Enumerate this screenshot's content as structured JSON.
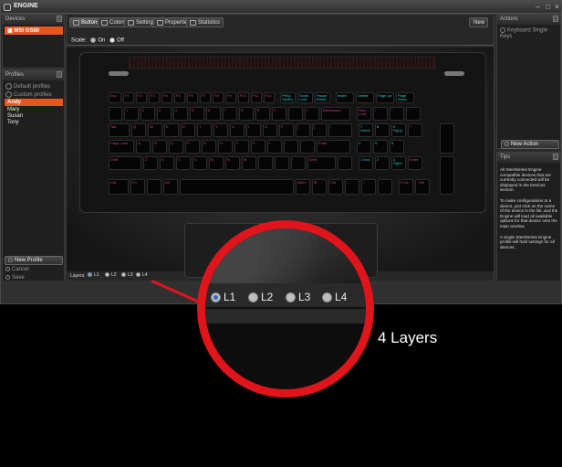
{
  "window": {
    "title": "ENGINE",
    "icon": "engine-logo-icon"
  },
  "devices": {
    "header": "Devices",
    "selected": "MSI GS60"
  },
  "profiles": {
    "header": "Profiles",
    "default_label": "Default profiles",
    "custom_label": "Custom profiles",
    "items": [
      "Andy",
      "Mary",
      "Susan",
      "Tony"
    ],
    "selected": "Andy",
    "new_profile_label": "New Profile",
    "cancel_label": "Cancel",
    "save_label": "Save"
  },
  "tabs": [
    {
      "label": "Buttons",
      "icon": "buttons-icon"
    },
    {
      "label": "Colors",
      "icon": "colors-icon"
    },
    {
      "label": "Settings",
      "icon": "settings-icon"
    },
    {
      "label": "Properties",
      "icon": "properties-icon"
    },
    {
      "label": "Statistics",
      "icon": "statistics-icon"
    }
  ],
  "new_label": "New",
  "scale": {
    "label": "Scale:",
    "on": "On",
    "off": "Off"
  },
  "actions": {
    "header": "Actions",
    "item": "Keyboard Single Keys",
    "new_action_label": "New Action"
  },
  "tips": {
    "header": "Tips",
    "p1": "All SteelSeries Engine compatible devices that are currently connected will be displayed in the Devices section.",
    "p2": "To make configurations to a device, just click on the name of the device in the list, and the Engine will load all available options for that device onto the main window.",
    "p3": "A single SteelSeries Engine profile will hold settings for all devices."
  },
  "layers": {
    "label": "Layers:",
    "items": [
      "L1",
      "L2",
      "L3",
      "L4"
    ],
    "selected": "L1"
  },
  "callout": "4 Layers",
  "keys": {
    "fn_row": [
      "Esc",
      "F1",
      "F2",
      "F3",
      "F4",
      "F5",
      "F6",
      "F7",
      "F8",
      "F9",
      "F10",
      "F11",
      "F12",
      "PrtSc SysRq",
      "Scroll Lock",
      "Pause Break",
      "Insert",
      "Delete",
      "Page Up",
      "Page Down"
    ],
    "num_row": [
      "~",
      "1",
      "2",
      "3",
      "4",
      "5",
      "6",
      "7",
      "8",
      "9",
      "0",
      "-",
      "=",
      "Backspace",
      "Num Lock",
      "/",
      "*",
      "-"
    ],
    "tab_row": [
      "Tab",
      "Q",
      "W",
      "E",
      "R",
      "T",
      "Y",
      "U",
      "I",
      "O",
      "P",
      "[",
      "]",
      "\\",
      "7 Home",
      "8",
      "9 PgUp",
      "+"
    ],
    "caps_row": [
      "Caps Lock",
      "A",
      "S",
      "D",
      "F",
      "G",
      "H",
      "J",
      "K",
      "L",
      ";",
      "'",
      "Enter",
      "4",
      "5",
      "6"
    ],
    "shift_row": [
      "Shift",
      "Z",
      "X",
      "C",
      "V",
      "B",
      "N",
      "M",
      ",",
      ".",
      "/",
      "Shift",
      "↑",
      "1 End",
      "2",
      "3 PgDn",
      "Enter"
    ],
    "ctrl_row": [
      "Ctrl",
      "Fn",
      "",
      "Alt",
      "",
      "AltGr",
      "⊞",
      "Ctrl",
      "←",
      "↓",
      "→",
      "0 Ins",
      ". Del"
    ]
  },
  "colors": {
    "accent": "#e8561d",
    "key_primary": "#d33c8a",
    "key_secondary": "#2bd0d6",
    "magnifier_ring": "#e0141b"
  }
}
